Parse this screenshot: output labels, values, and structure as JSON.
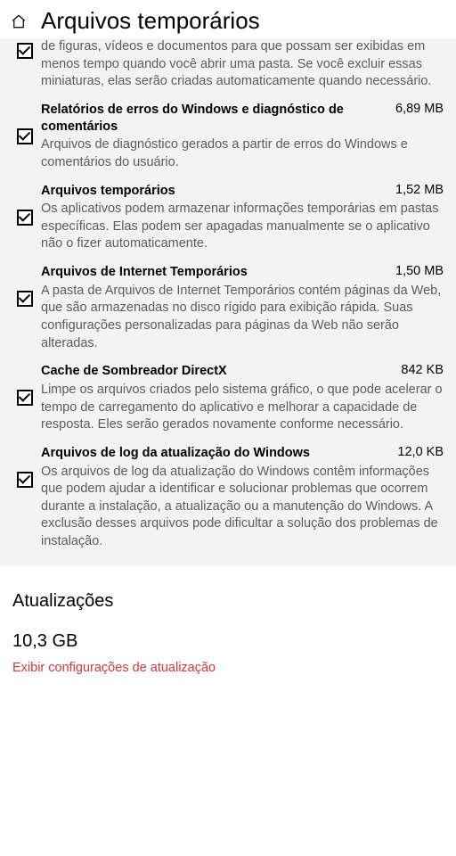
{
  "header": {
    "title": "Arquivos temporários"
  },
  "temp_items": [
    {
      "checked": true,
      "title": "",
      "size": "",
      "desc": "de figuras, vídeos e documentos para que possam ser exibidas em menos tempo quando você abrir uma pasta. Se você excluir essas miniaturas, elas serão criadas automaticamente quando necessário.",
      "cut": true
    },
    {
      "checked": true,
      "title": "Relatórios de erros do Windows e diagnóstico de comentários",
      "size": "6,89 MB",
      "desc": "Arquivos de diagnóstico gerados a partir de erros do Windows e comentários do usuário."
    },
    {
      "checked": true,
      "title": "Arquivos temporários",
      "size": "1,52 MB",
      "desc": "Os aplicativos podem armazenar informações temporárias em pastas específicas. Elas podem ser apagadas manualmente se o aplicativo não o fizer automaticamente."
    },
    {
      "checked": true,
      "title": "Arquivos de Internet Temporários",
      "size": "1,50 MB",
      "desc": "A pasta de Arquivos de Internet Temporários contém páginas da Web, que são armazenadas no disco rígido para exibição rápida. Suas configurações personalizadas para páginas da Web não serão alteradas."
    },
    {
      "checked": true,
      "title": "Cache de Sombreador DirectX",
      "size": "842 KB",
      "desc": "Limpe os arquivos criados pelo sistema gráfico, o que pode acelerar o tempo de carregamento do aplicativo e melhorar a capacidade de resposta. Eles serão gerados novamente conforme necessário."
    },
    {
      "checked": true,
      "title": "Arquivos de log da atualização do Windows",
      "size": "12,0 KB",
      "desc": "Os arquivos de log da atualização do Windows contêm informações que podem ajudar a identificar e solucionar problemas que ocorrem durante a instalação, a atualização ou a manutenção do Windows. A exclusão desses arquivos pode dificultar a solução dos problemas de instalação."
    }
  ],
  "updates": {
    "heading": "Atualizações",
    "size": "10,3 GB",
    "link": "Exibir configurações de atualização"
  }
}
